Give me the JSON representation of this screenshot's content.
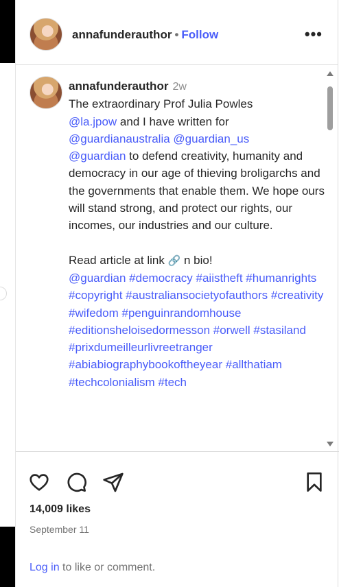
{
  "header": {
    "username": "annafunderauthor",
    "separator": "•",
    "follow_label": "Follow",
    "more_label": "•••"
  },
  "caption": {
    "username": "annafunderauthor",
    "relative_time": "2w",
    "line1_text": "The extraordinary Prof Julia Powles",
    "mention_1": "@la.jpow",
    "line2_text": " and I have written for",
    "mention_2": "@guardianaustralia",
    "mention_3": "@guardian_us",
    "mention_4": "@guardian",
    "body_text": " to defend creativity, humanity and democracy in our age of thieving broligarchs and the governments that enable them. We hope ours will stand strong, and protect our rights, our incomes, our industries and our culture.",
    "read_article_before": "Read article at link ",
    "link_emoji": "🔗",
    "read_article_after": " n bio!",
    "hashtag_mention": "@guardian",
    "hashtags": [
      "#democracy",
      "#aiistheft",
      "#humanrights",
      "#copyright",
      "#australiansocietyofauthors",
      "#creativity",
      "#wifedom",
      "#penguinrandomhouse",
      "#editionsheloisedormesson",
      "#orwell",
      "#stasiland",
      "#prixdumeilleurlivreetranger",
      "#abiabiographybookoftheyear",
      "#allthatiam",
      "#techcolonialism",
      "#tech"
    ]
  },
  "actions": {
    "likes": "14,009 likes",
    "date": "September 11",
    "login_link": "Log in",
    "login_rest": " to like or comment."
  },
  "icons": {
    "like": "heart-icon",
    "comment": "comment-bubble-icon",
    "share": "paper-plane-icon",
    "save": "bookmark-icon",
    "more": "more-options-icon"
  }
}
